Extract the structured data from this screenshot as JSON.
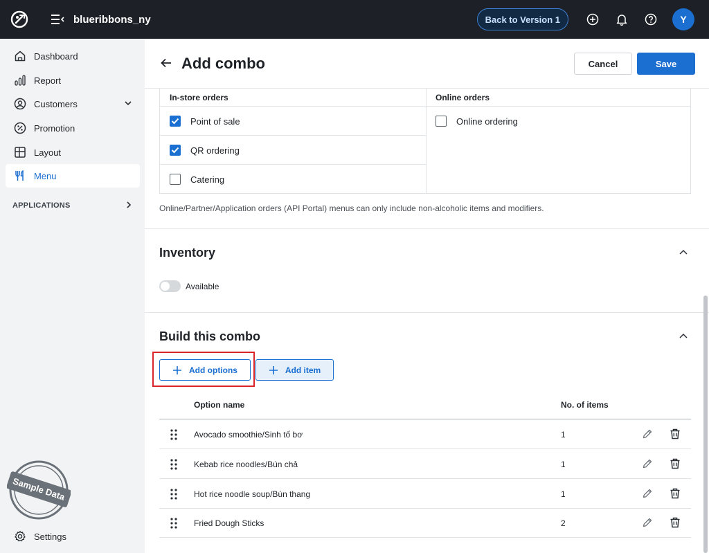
{
  "topbar": {
    "brand": "blueribbons_ny",
    "back_button": "Back to Version 1",
    "avatar_initial": "Y",
    "icons": [
      "logo-icon",
      "menu-toggle-icon",
      "add-circle-icon",
      "bell-icon",
      "help-icon"
    ]
  },
  "sidebar": {
    "items": [
      {
        "label": "Dashboard",
        "icon": "home-icon"
      },
      {
        "label": "Report",
        "icon": "bar-chart-icon"
      },
      {
        "label": "Customers",
        "icon": "user-circle-icon"
      },
      {
        "label": "Promotion",
        "icon": "percent-icon"
      },
      {
        "label": "Layout",
        "icon": "layout-icon"
      },
      {
        "label": "Menu",
        "icon": "fork-knife-icon",
        "active": true
      }
    ],
    "applications_label": "APPLICATIONS",
    "stamp_text": "Sample Data",
    "settings_label": "Settings"
  },
  "header": {
    "title": "Add combo",
    "cancel": "Cancel",
    "save": "Save"
  },
  "channels": {
    "instore_header": "In-store orders",
    "online_header": "Online orders",
    "instore": [
      {
        "label": "Point of sale",
        "checked": true
      },
      {
        "label": "QR ordering",
        "checked": true
      },
      {
        "label": "Catering",
        "checked": false
      }
    ],
    "online": [
      {
        "label": "Online ordering",
        "checked": false
      }
    ],
    "note": "Online/Partner/Application orders (API Portal) menus can only include non-alcoholic items and modifiers."
  },
  "inventory": {
    "title": "Inventory",
    "toggle_label": "Available",
    "toggle_on": false
  },
  "combo": {
    "title": "Build this combo",
    "add_options": "Add options",
    "add_item": "Add item",
    "col_option": "Option name",
    "col_count": "No. of items",
    "rows": [
      {
        "name": "Avocado smoothie/Sinh tố bơ",
        "count": "1"
      },
      {
        "name": "Kebab rice noodles/Bún chả",
        "count": "1"
      },
      {
        "name": "Hot rice noodle soup/Bún thang",
        "count": "1"
      },
      {
        "name": "Fried Dough Sticks",
        "count": "2"
      }
    ]
  },
  "colors": {
    "accent": "#1a6fd1",
    "topbar": "#1d2026",
    "sidebar": "#f2f3f4",
    "highlight": "#d9252a"
  }
}
